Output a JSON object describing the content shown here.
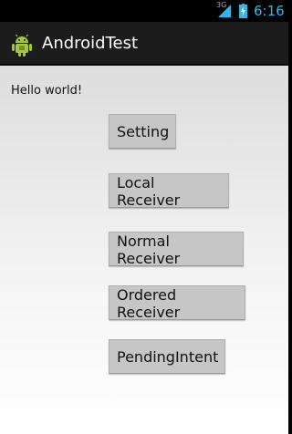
{
  "status_bar": {
    "network": "3G",
    "time": "6:16",
    "icons": [
      "signal-icon",
      "battery-charging-icon"
    ]
  },
  "action_bar": {
    "title": "AndroidTest",
    "icon": "android-icon"
  },
  "content": {
    "hello_text": "Hello world!",
    "buttons": [
      {
        "label": "Setting"
      },
      {
        "label": "Local Receiver"
      },
      {
        "label": "Normal Receiver"
      },
      {
        "label": "Ordered Receiver"
      },
      {
        "label": "PendingIntent"
      }
    ]
  },
  "colors": {
    "clock": "#33b5e5",
    "action_bar": "#1c1c1c",
    "button": "#c6c6c6"
  }
}
